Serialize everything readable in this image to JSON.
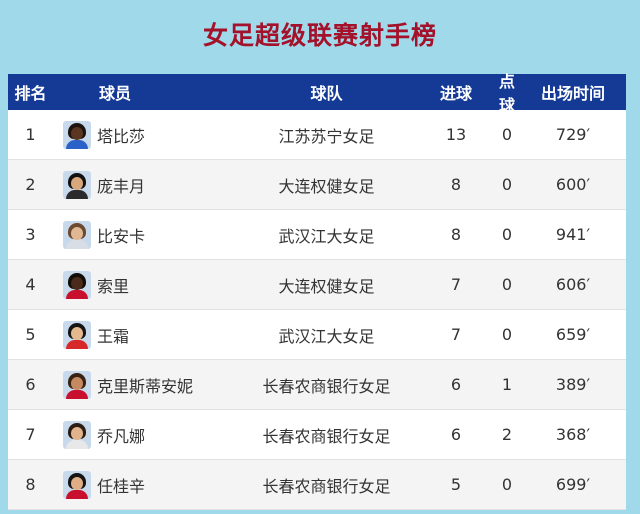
{
  "title": "女足超级联赛射手榜",
  "table": {
    "headers": {
      "rank": "排名",
      "player": "球员",
      "team": "球队",
      "goals": "进球",
      "penalties": "点球",
      "time": "出场时间"
    },
    "rows": [
      {
        "rank": "1",
        "player": "塔比莎",
        "team": "江苏苏宁女足",
        "goals": "13",
        "penalties": "0",
        "time": "729′"
      },
      {
        "rank": "2",
        "player": "庞丰月",
        "team": "大连权健女足",
        "goals": "8",
        "penalties": "0",
        "time": "600′"
      },
      {
        "rank": "3",
        "player": "比安卡",
        "team": "武汉江大女足",
        "goals": "8",
        "penalties": "0",
        "time": "941′"
      },
      {
        "rank": "4",
        "player": "索里",
        "team": "大连权健女足",
        "goals": "7",
        "penalties": "0",
        "time": "606′"
      },
      {
        "rank": "5",
        "player": "王霜",
        "team": "武汉江大女足",
        "goals": "7",
        "penalties": "0",
        "time": "659′"
      },
      {
        "rank": "6",
        "player": "克里斯蒂安妮",
        "team": "长春农商银行女足",
        "goals": "6",
        "penalties": "1",
        "time": "389′"
      },
      {
        "rank": "7",
        "player": "乔凡娜",
        "team": "长春农商银行女足",
        "goals": "6",
        "penalties": "2",
        "time": "368′"
      },
      {
        "rank": "8",
        "player": "任桂辛",
        "team": "长春农商银行女足",
        "goals": "5",
        "penalties": "0",
        "time": "699′"
      }
    ]
  },
  "colors": {
    "background": "#9fd9ea",
    "title": "#a3112a",
    "header": "#143a96"
  }
}
